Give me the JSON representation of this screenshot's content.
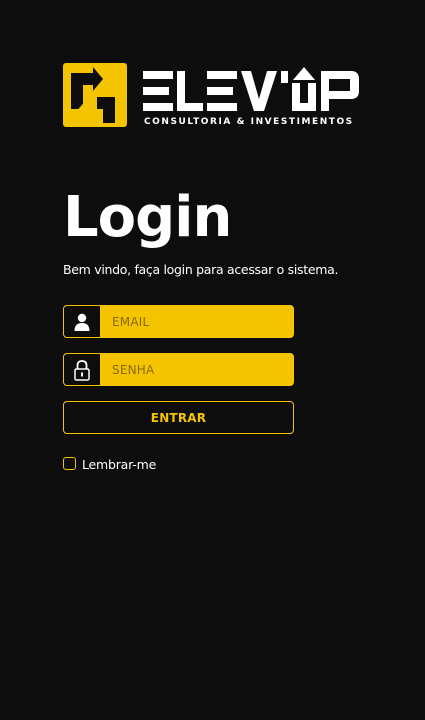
{
  "brand": {
    "logo_subtitle": "CONSULTORIA & INVESTIMENTOS",
    "colors": {
      "accent": "#f5c400",
      "background": "#0d0d0d",
      "text": "#ffffff"
    }
  },
  "login": {
    "title": "Login",
    "subtitle": "Bem vindo, faça login para acessar o sistema.",
    "email_placeholder": "EMAIL",
    "password_placeholder": "SENHA",
    "submit_label": "ENTRAR",
    "remember_label": "Lembrar-me",
    "remember_checked": false
  },
  "icons": {
    "email": "user-icon",
    "password": "lock-icon"
  }
}
